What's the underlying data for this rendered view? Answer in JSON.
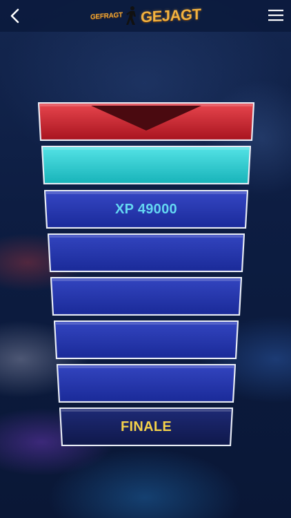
{
  "header": {
    "logo_small": "GEFRAGT",
    "logo_big": "GEJAGT",
    "back_icon": "chevron-left-icon",
    "menu_icon": "hamburger-menu-icon"
  },
  "ladder": {
    "steps": [
      {
        "kind": "chaser",
        "label": "",
        "fill_top": "#e8464e",
        "fill_bottom": "#a8141f"
      },
      {
        "kind": "player",
        "label": "",
        "fill_top": "#55e3e6",
        "fill_bottom": "#17b3b9"
      },
      {
        "kind": "amount",
        "label": "XP 49000",
        "fill_top": "#3647c4",
        "fill_bottom": "#1a2a9a",
        "text_color": "#64d8f2"
      },
      {
        "kind": "empty",
        "label": "",
        "fill_top": "#3345c0",
        "fill_bottom": "#1a2a98"
      },
      {
        "kind": "empty",
        "label": "",
        "fill_top": "#3345c0",
        "fill_bottom": "#1a2a98"
      },
      {
        "kind": "empty",
        "label": "",
        "fill_top": "#3345c0",
        "fill_bottom": "#1a2a98"
      },
      {
        "kind": "empty",
        "label": "",
        "fill_top": "#3345c0",
        "fill_bottom": "#1a2a98"
      },
      {
        "kind": "finale",
        "label": "FINALE",
        "fill_top": "#1e2a76",
        "fill_bottom": "#0f184a",
        "text_color": "#f5d24a"
      }
    ]
  }
}
